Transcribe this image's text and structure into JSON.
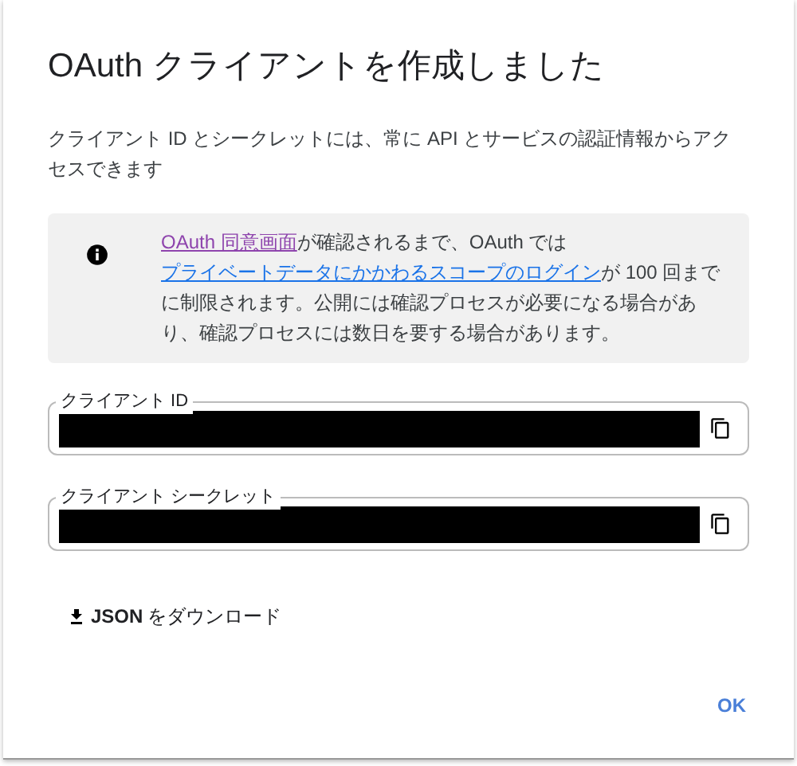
{
  "dialog": {
    "title": "OAuth クライアントを作成しました",
    "description": "クライアント ID とシークレットには、常に API とサービスの認証情報からアクセスできます",
    "notice": [
      {
        "kind": "link",
        "text": "OAuth 同意画面",
        "visited": true
      },
      {
        "kind": "text",
        "text": "が確認されるまで、OAuth では"
      },
      {
        "kind": "link",
        "text": "プライベートデータにかかわるスコープのログイン",
        "visited": false
      },
      {
        "kind": "text",
        "text": "が 100 回までに制限されます。公開には確認プロセスが必要になる場合があり、確認プロセスには数日を要する場合があります。"
      }
    ],
    "fields": [
      {
        "label": "クライアント ID",
        "redacted": true
      },
      {
        "label": "クライアント シークレット",
        "redacted": true
      }
    ],
    "download_button": "JSON をダウンロード",
    "ok_button": "OK"
  }
}
